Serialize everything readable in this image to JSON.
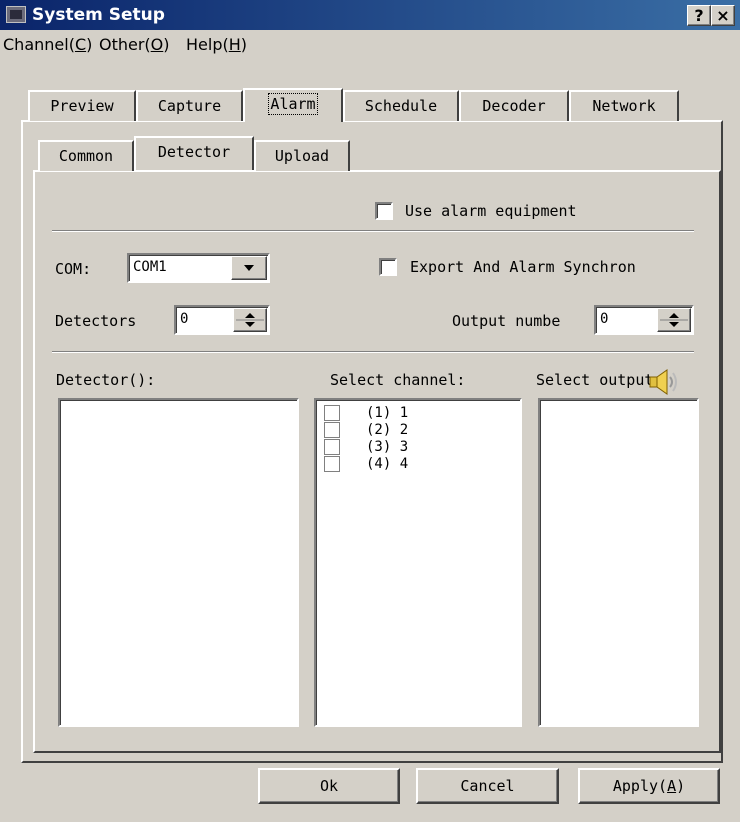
{
  "window": {
    "title": "System Setup",
    "help_button": "?",
    "close_button": "×"
  },
  "menu": [
    {
      "label": "Channel(",
      "mnemonic": "C",
      "suffix": ")"
    },
    {
      "label": "Other(",
      "mnemonic": "O",
      "suffix": ")"
    },
    {
      "label": "Help(",
      "mnemonic": "H",
      "suffix": ")"
    }
  ],
  "main_tabs": [
    "Preview",
    "Capture",
    "Alarm",
    "Schedule",
    "Decoder",
    "Network"
  ],
  "main_tab_active": "Alarm",
  "sub_tabs": [
    "Common",
    "Detector",
    "Upload"
  ],
  "sub_tab_active": "Detector",
  "detector": {
    "use_alarm_equipment_label": "Use alarm equipment",
    "use_alarm_equipment_checked": false,
    "com_label": "COM:",
    "com_value": "COM1",
    "export_sync_label": "Export And Alarm Synchron",
    "export_sync_checked": false,
    "detectors_label": "Detectors",
    "detectors_value": "0",
    "output_number_label": "Output numbe",
    "output_number_value": "0",
    "detector_list_label": "Detector():",
    "select_channel_label": "Select channel:",
    "select_output_label": "Select output:",
    "channels": [
      {
        "label": "(1) 1",
        "checked": false
      },
      {
        "label": "(2) 2",
        "checked": false
      },
      {
        "label": "(3) 3",
        "checked": false
      },
      {
        "label": "(4) 4",
        "checked": false
      }
    ]
  },
  "buttons": {
    "ok": "Ok",
    "cancel": "Cancel",
    "apply": "Apply(",
    "apply_mnemonic": "A",
    "apply_suffix": ")"
  },
  "icons": {
    "app": "app-icon",
    "speaker": "speaker-icon"
  },
  "colors": {
    "title_gradient_start": "#0a246a",
    "title_gradient_end": "#3a6ea5",
    "face": "#d4d0c8"
  }
}
